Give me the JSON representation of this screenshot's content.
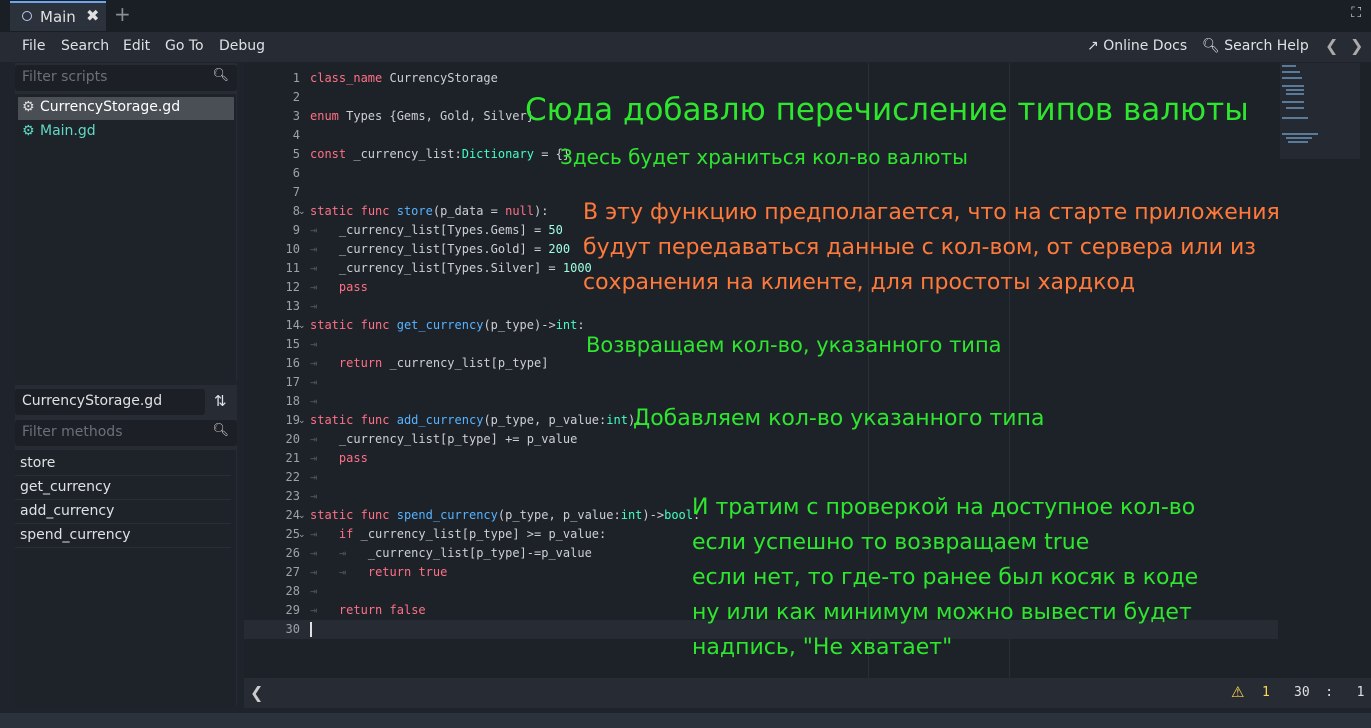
{
  "tab": {
    "title": "Main",
    "close": "✖",
    "add": "+"
  },
  "menu": {
    "items": [
      "File",
      "Search",
      "Edit",
      "Go To",
      "Debug"
    ],
    "online_docs": "Online Docs",
    "search_help": "Search Help"
  },
  "scripts_panel": {
    "filter_placeholder": "Filter scripts",
    "items": [
      {
        "label": "CurrencyStorage.gd",
        "color": "#ffffff",
        "selected": true
      },
      {
        "label": "Main.gd",
        "color": "#5fd9c4",
        "selected": false
      }
    ]
  },
  "methods_panel": {
    "file_label": "CurrencyStorage.gd",
    "filter_placeholder": "Filter methods",
    "items": [
      "store",
      "get_currency",
      "add_currency",
      "spend_currency"
    ]
  },
  "editor": {
    "line_numbers": [
      "1",
      "2",
      "3",
      "4",
      "5",
      "6",
      "7",
      "8",
      "9",
      "10",
      "11",
      "12",
      "13",
      "14",
      "15",
      "16",
      "17",
      "18",
      "19",
      "20",
      "21",
      "22",
      "23",
      "24",
      "25",
      "26",
      "27",
      "28",
      "29",
      "30"
    ],
    "code": [
      "class_name CurrencyStorage",
      "",
      "enum Types {Gems, Gold, Silver}",
      "",
      "const _currency_list:Dictionary = {}",
      "",
      "",
      "static func store(p_data = null):",
      "    _currency_list[Types.Gems] = 50",
      "    _currency_list[Types.Gold] = 200",
      "    _currency_list[Types.Silver] = 1000",
      "    pass",
      "",
      "static func get_currency(p_type)->int:",
      "",
      "    return _currency_list[p_type]",
      "",
      "",
      "static func add_currency(p_type, p_value:int):",
      "    _currency_list[p_type] += p_value",
      "    pass",
      "",
      "",
      "static func spend_currency(p_type, p_value:int)->bool:",
      "    if _currency_list[p_type] >= p_value:",
      "        _currency_list[p_type]-=p_value",
      "        return true",
      "",
      "    return false",
      ""
    ]
  },
  "annotations": {
    "a1": "Сюда добавлю перечисление типов валюты",
    "a2": "Здесь будет храниться кол-во валюты",
    "a3": "В эту функцию предполагается, что на старте приложения\nбудут передаваться данные с кол-вом, от сервера или из\nсохранения на клиенте, для простоты хардкод",
    "a4": "Возвращаем кол-во, указанного типа",
    "a5": "Добавляем кол-во указанного типа",
    "a6": "И тратим с проверкой на доступное кол-во\nесли успешно то возвращаем true\nесли нет, то где-то ранее был косяк в коде\nну или как минимум можно вывести будет\nнадпись, \"Не хватает\""
  },
  "status": {
    "back": "❮",
    "warnings": "1",
    "line": "30",
    "col": "1"
  },
  "colors": {
    "annotation_green": "#2ee62e",
    "annotation_orange": "#ff7a3a",
    "keyword": "#ff7085",
    "function": "#57b3ff",
    "number": "#a1ffe0",
    "type": "#42ffc2"
  }
}
